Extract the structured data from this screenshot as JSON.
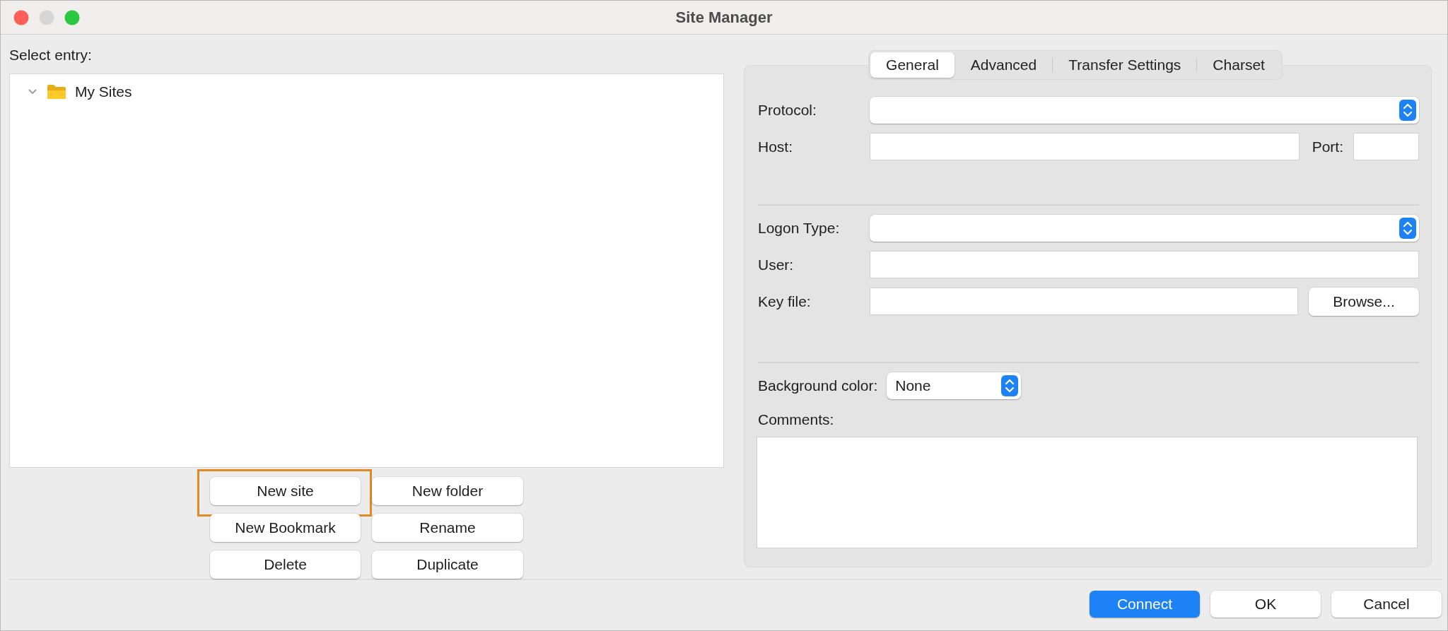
{
  "window": {
    "title": "Site Manager"
  },
  "entry_label": "Select entry:",
  "tree": [
    {
      "label": "My Sites",
      "expanded": true
    }
  ],
  "tree_buttons": [
    {
      "label": "New site",
      "highlighted": true
    },
    {
      "label": "New folder",
      "highlighted": false
    },
    {
      "label": "New Bookmark",
      "highlighted": false
    },
    {
      "label": "Rename",
      "highlighted": false
    },
    {
      "label": "Delete",
      "highlighted": false
    },
    {
      "label": "Duplicate",
      "highlighted": false
    }
  ],
  "tabs": [
    {
      "label": "General",
      "selected": true
    },
    {
      "label": "Advanced",
      "selected": false
    },
    {
      "label": "Transfer Settings",
      "selected": false
    },
    {
      "label": "Charset",
      "selected": false
    }
  ],
  "connection_fields": [
    {
      "kind": "select",
      "label": "Protocol:"
    },
    {
      "kind": "text_port",
      "label": "Host:",
      "port_label": "Port:"
    }
  ],
  "logon_fields": [
    {
      "kind": "select",
      "label": "Logon Type:"
    },
    {
      "kind": "text",
      "label": "User:"
    },
    {
      "kind": "file",
      "label": "Key file:",
      "button": "Browse..."
    }
  ],
  "background_color": {
    "label": "Background color:",
    "value": "None"
  },
  "comments": {
    "label": "Comments:"
  },
  "footer_buttons": [
    {
      "label": "Connect",
      "default": true
    },
    {
      "label": "OK",
      "default": false
    },
    {
      "label": "Cancel",
      "default": false
    }
  ]
}
